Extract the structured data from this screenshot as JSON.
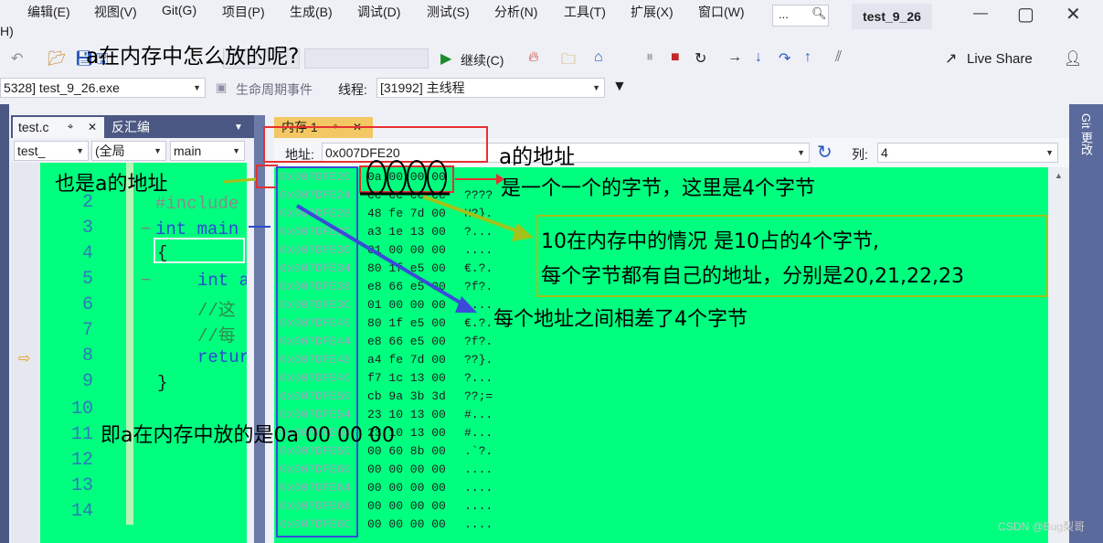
{
  "menu": {
    "items": [
      "编辑(E)",
      "视图(V)",
      "Git(G)",
      "项目(P)",
      "生成(B)",
      "调试(D)",
      "测试(S)",
      "分析(N)",
      "工具(T)",
      "扩展(X)",
      "窗口(W)"
    ],
    "help_fragment": "H)",
    "search_placeholder": "...",
    "solution_title": "test_9_26"
  },
  "toolbar": {
    "continue_label": "继续(C)",
    "live_share": "Live Share"
  },
  "debug_bar": {
    "process": "5328] test_9_26.exe",
    "lifecycle": "生命周期事件",
    "thread_label": "线程:",
    "thread_value": "[31992] 主线程"
  },
  "editor": {
    "tab_file": "test.c",
    "tab_disasm": "反汇编",
    "nav_file": "test_",
    "nav_scope": "(全局",
    "nav_func": "main",
    "line_numbers": [
      "2",
      "3",
      "4",
      "5",
      "6",
      "7",
      "8",
      "9",
      "10",
      "11",
      "12",
      "13",
      "14"
    ],
    "code_lines": [
      "#include",
      "int main",
      "{",
      "int a",
      "//这",
      "//每",
      "retur",
      "}"
    ]
  },
  "memory": {
    "tab_label": "内存 1",
    "address_label": "地址:",
    "address_value": "0x007DFE20",
    "columns_label": "列:",
    "columns_value": "4",
    "rows": [
      {
        "addr": "0x007DFE20",
        "bytes": "0a 00 00 00",
        "chars": "...."
      },
      {
        "addr": "0x007DFE24",
        "bytes": "cc cc cc cc",
        "chars": "????"
      },
      {
        "addr": "0x007DFE28",
        "bytes": "48 fe 7d 00",
        "chars": "H?}."
      },
      {
        "addr": "0x007DFE2C",
        "bytes": "a3 1e 13 00",
        "chars": "?..."
      },
      {
        "addr": "0x007DFE30",
        "bytes": "01 00 00 00",
        "chars": "...."
      },
      {
        "addr": "0x007DFE34",
        "bytes": "80 1f e5 00",
        "chars": "€.?."
      },
      {
        "addr": "0x007DFE38",
        "bytes": "e8 66 e5 00",
        "chars": "?f?."
      },
      {
        "addr": "0x007DFE3C",
        "bytes": "01 00 00 00",
        "chars": "...."
      },
      {
        "addr": "0x007DFE40",
        "bytes": "80 1f e5 00",
        "chars": "€.?."
      },
      {
        "addr": "0x007DFE44",
        "bytes": "e8 66 e5 00",
        "chars": "?f?."
      },
      {
        "addr": "0x007DFE48",
        "bytes": "a4 fe 7d 00",
        "chars": "??}."
      },
      {
        "addr": "0x007DFE4C",
        "bytes": "f7 1c 13 00",
        "chars": "?..."
      },
      {
        "addr": "0x007DFE50",
        "bytes": "cb 9a 3b 3d",
        "chars": "??;="
      },
      {
        "addr": "0x007DFE54",
        "bytes": "23 10 13 00",
        "chars": "#..."
      },
      {
        "addr": "0x007DFE58",
        "bytes": "23 10 13 00",
        "chars": "#..."
      },
      {
        "addr": "0x007DFE5C",
        "bytes": "00 60 8b 00",
        "chars": ".`?."
      },
      {
        "addr": "0x007DFE60",
        "bytes": "00 00 00 00",
        "chars": "...."
      },
      {
        "addr": "0x007DFE64",
        "bytes": "00 00 00 00",
        "chars": "...."
      },
      {
        "addr": "0x007DFE68",
        "bytes": "00 00 00 00",
        "chars": "...."
      },
      {
        "addr": "0x007DFE6C",
        "bytes": "00 00 00 00",
        "chars": "...."
      }
    ]
  },
  "annotations": {
    "question": "a在内存中怎么放的呢?",
    "addr_of_a": "a的地址",
    "also_addr": "也是a的地址",
    "bytes_note": "是一个一个的字节，这里是4个字节",
    "ten_line1": "10在内存中的情况 是10占的4个字节,",
    "ten_line2": "每个字节都有自己的地址，分别是20,21,22,23",
    "step_note": "每个地址之间相差了4个字节",
    "result_note": "即a在内存中放的是0a 00 00 00"
  },
  "watermark": "CSDN @Bug梨哥",
  "colors": {
    "highlight_green": "#00ff7f",
    "tab_yellow": "#f3c763",
    "frame_blue": "#4b5883"
  }
}
